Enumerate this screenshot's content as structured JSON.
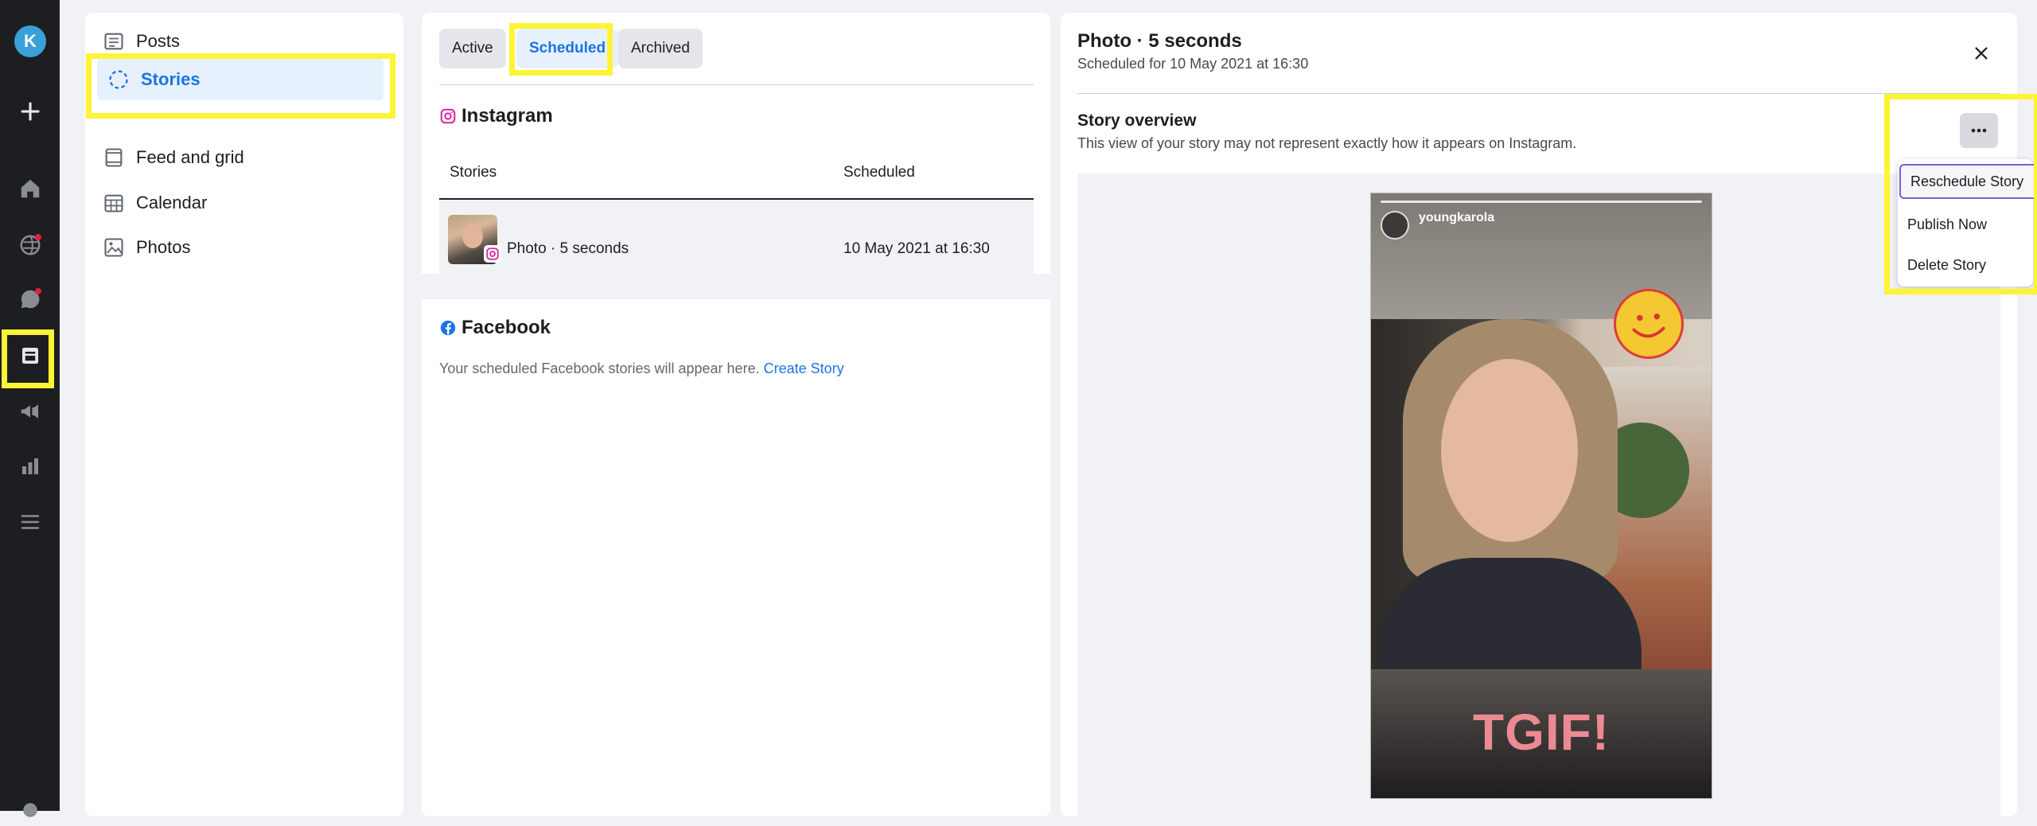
{
  "rail": {
    "avatar_initial": "K",
    "icons": [
      "plus-icon",
      "home-icon",
      "globe-icon",
      "chat-icon",
      "stories-icon",
      "megaphone-icon",
      "bar-chart-icon",
      "menu-lines-icon",
      "settings-icon"
    ]
  },
  "nav": {
    "items": [
      {
        "label": "Posts",
        "icon": "posts-icon"
      },
      {
        "label": "Stories",
        "icon": "stories-icon"
      },
      {
        "label": "Feed and grid",
        "icon": "feed-grid-icon"
      },
      {
        "label": "Calendar",
        "icon": "calendar-icon"
      },
      {
        "label": "Photos",
        "icon": "photos-icon"
      }
    ]
  },
  "tabs": [
    "Active",
    "Scheduled",
    "Archived"
  ],
  "instagram": {
    "title": "Instagram",
    "columns": [
      "Stories",
      "Scheduled"
    ],
    "rows": [
      {
        "story": "Photo · 5 seconds",
        "scheduled": "10 May 2021 at 16:30"
      }
    ]
  },
  "facebook": {
    "title": "Facebook",
    "note": "Your scheduled Facebook stories will appear here.",
    "link": "Create Story"
  },
  "detail": {
    "title": "Photo · 5 seconds",
    "subtitle": "Scheduled for 10 May 2021 at 16:30",
    "overview_title": "Story overview",
    "overview_sub": "This view of your story may not represent exactly how it appears on Instagram."
  },
  "story": {
    "username": "youngkarola",
    "caption": "TGIF!"
  },
  "menu": {
    "items": [
      "Reschedule Story",
      "Publish Now",
      "Delete Story"
    ]
  },
  "colors": {
    "accent": "#1b74e4",
    "highlight": "#fcf434",
    "rail": "#1c1e21"
  }
}
